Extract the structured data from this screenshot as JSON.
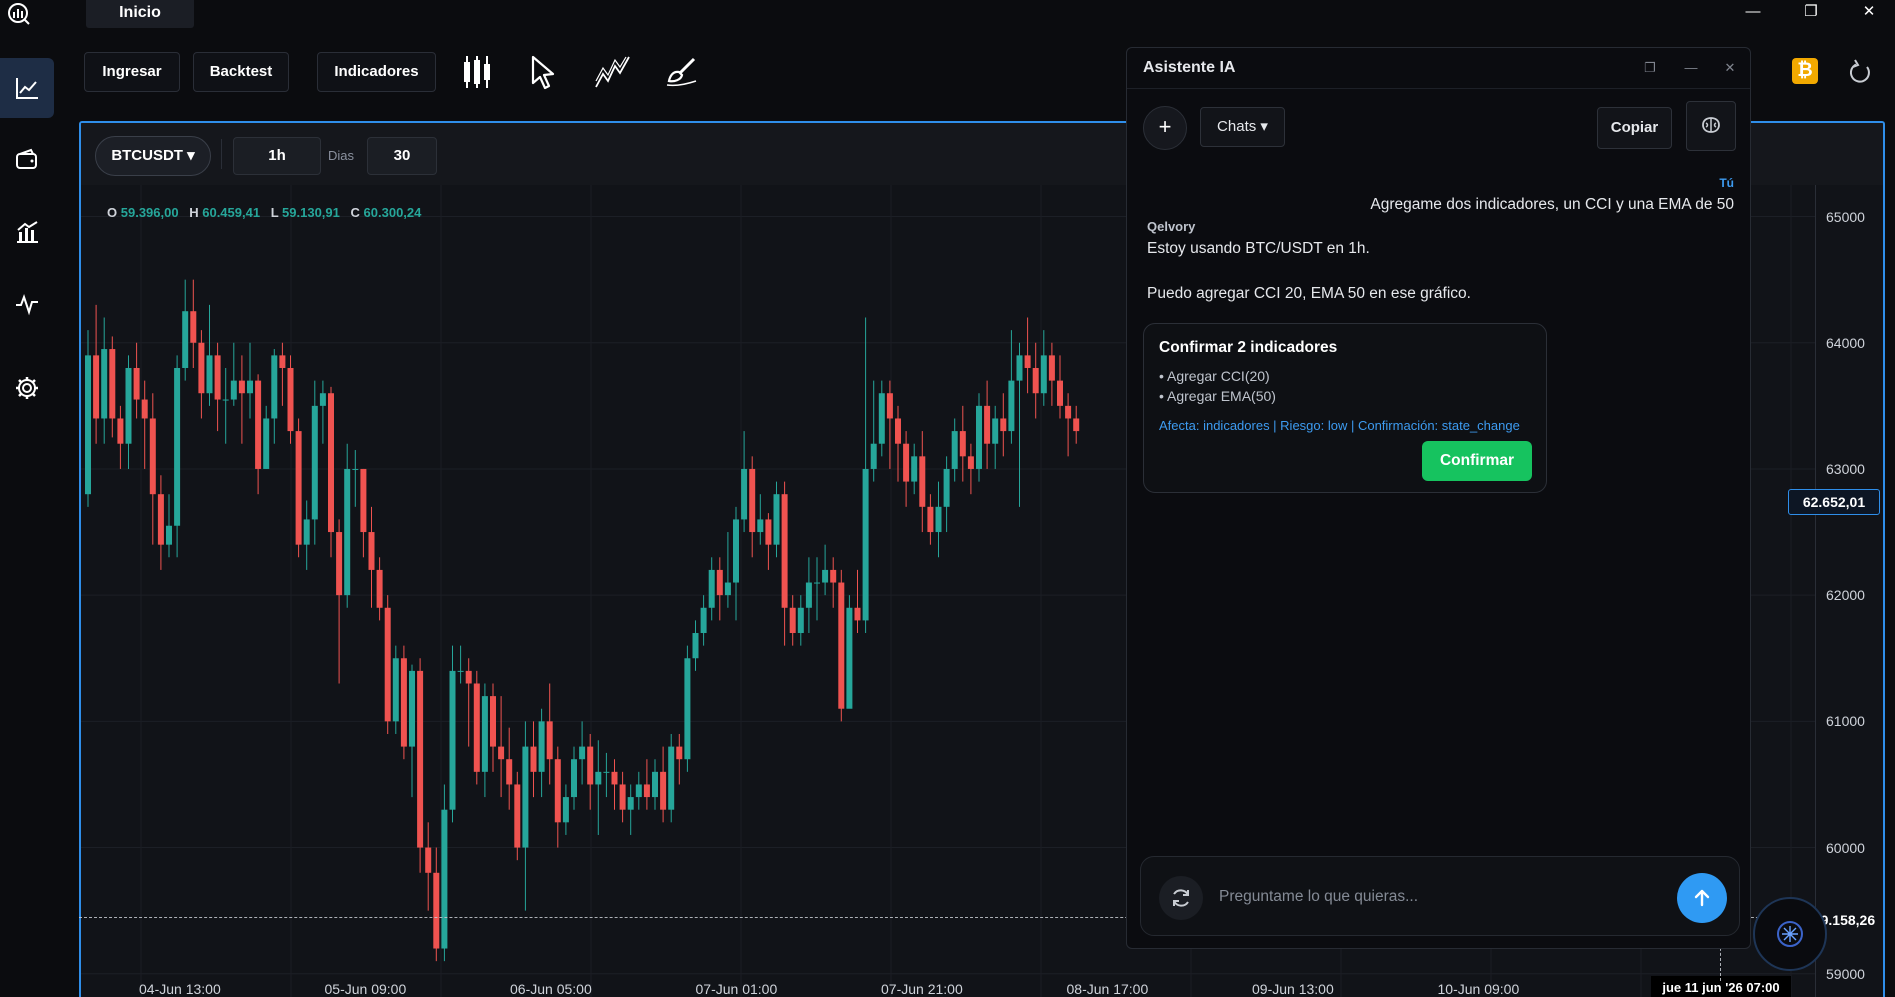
{
  "window": {
    "tab_label": "Inicio",
    "minimize": "—",
    "maximize": "❐",
    "close": "✕"
  },
  "toolbar": {
    "ingresar": "Ingresar",
    "backtest": "Backtest",
    "indicadores": "Indicadores"
  },
  "chart": {
    "symbol": "BTCUSDT ▾",
    "interval": "1h",
    "days_label": "Dias",
    "days_value": "30",
    "ohlc": {
      "o_label": "O",
      "o": "59.396,00",
      "h_label": "H",
      "h": "60.459,41",
      "l_label": "L",
      "l": "59.130,91",
      "c_label": "C",
      "c": "60.300,24"
    },
    "current_price": "62.652,01",
    "crosshair_price": "59.158,26",
    "crosshair_time": "jue 11 jun '26  07:00",
    "up_color": "#26a69a",
    "down_color": "#ef5350",
    "price_ticks": [
      "65000",
      "64000",
      "63000",
      "62000",
      "61000",
      "60000",
      "59000"
    ],
    "time_ticks": [
      "04-Jun 13:00",
      "05-Jun 09:00",
      "06-Jun 05:00",
      "07-Jun 01:00",
      "07-Jun 21:00",
      "08-Jun 17:00",
      "09-Jun 13:00",
      "10-Jun 09:00"
    ]
  },
  "chart_data": {
    "type": "candlestick",
    "ylim": [
      58800,
      65250
    ],
    "x_unit": "1h candles",
    "candles": [
      [
        62800,
        63900,
        64100,
        62700
      ],
      [
        63900,
        63400,
        64300,
        63200
      ],
      [
        63400,
        63950,
        64200,
        63200
      ],
      [
        63950,
        63400,
        64050,
        63250
      ],
      [
        63400,
        63200,
        63500,
        63000
      ],
      [
        63200,
        63800,
        63900,
        63000
      ],
      [
        63800,
        63550,
        64000,
        63400
      ],
      [
        63550,
        63400,
        63700,
        63000
      ],
      [
        63400,
        62800,
        63600,
        62400
      ],
      [
        62800,
        62400,
        62950,
        62200
      ],
      [
        62400,
        62550,
        62800,
        62300
      ],
      [
        62550,
        63800,
        63900,
        62300
      ],
      [
        63800,
        64250,
        64500,
        63700
      ],
      [
        64250,
        64000,
        64500,
        63800
      ],
      [
        64000,
        63600,
        64100,
        63400
      ],
      [
        63600,
        63900,
        64300,
        63500
      ],
      [
        63900,
        63550,
        64000,
        63300
      ],
      [
        63550,
        63550,
        63800,
        63200
      ],
      [
        63550,
        63700,
        64000,
        63500
      ],
      [
        63700,
        63600,
        63900,
        63200
      ],
      [
        63600,
        63700,
        64000,
        63400
      ],
      [
        63700,
        63000,
        63750,
        62800
      ],
      [
        63000,
        63400,
        63500,
        63000
      ],
      [
        63400,
        63900,
        63950,
        63200
      ],
      [
        63900,
        63800,
        64000,
        63500
      ],
      [
        63800,
        63300,
        63900,
        63200
      ],
      [
        63300,
        62400,
        63400,
        62300
      ],
      [
        62400,
        62600,
        62750,
        62200
      ],
      [
        62600,
        63500,
        63700,
        62400
      ],
      [
        63500,
        63600,
        63700,
        63200
      ],
      [
        63600,
        62500,
        63650,
        62300
      ],
      [
        62500,
        62000,
        62600,
        61300
      ],
      [
        62000,
        63000,
        63200,
        61900
      ],
      [
        63000,
        63000,
        63150,
        62700
      ],
      [
        63000,
        62500,
        63000,
        62300
      ],
      [
        62500,
        62200,
        62700,
        61900
      ],
      [
        62200,
        61900,
        62300,
        61800
      ],
      [
        61900,
        61000,
        62000,
        60900
      ],
      [
        61000,
        61500,
        61600,
        60900
      ],
      [
        61500,
        60800,
        61600,
        60700
      ],
      [
        60800,
        61400,
        61450,
        60400
      ],
      [
        61400,
        60000,
        61500,
        59800
      ],
      [
        60000,
        59800,
        60200,
        59500
      ],
      [
        59800,
        59200,
        60000,
        59100
      ],
      [
        59200,
        60300,
        60500,
        59100
      ],
      [
        60300,
        61400,
        61600,
        60200
      ],
      [
        61400,
        61400,
        61600,
        61300
      ],
      [
        61400,
        61300,
        61500,
        60800
      ],
      [
        61300,
        60600,
        61400,
        60500
      ],
      [
        60600,
        61200,
        61300,
        60400
      ],
      [
        61200,
        60800,
        61300,
        60600
      ],
      [
        60800,
        60700,
        61200,
        60400
      ],
      [
        60700,
        60500,
        60950,
        60300
      ],
      [
        60500,
        60000,
        60600,
        59900
      ],
      [
        60000,
        60800,
        61000,
        59500
      ],
      [
        60800,
        60600,
        61000,
        60400
      ],
      [
        60600,
        61000,
        61100,
        60400
      ],
      [
        61000,
        60700,
        61300,
        60500
      ],
      [
        60700,
        60200,
        60800,
        60000
      ],
      [
        60200,
        60400,
        60500,
        60100
      ],
      [
        60400,
        60700,
        60800,
        60300
      ],
      [
        60700,
        60800,
        61000,
        60500
      ],
      [
        60800,
        60500,
        60900,
        60300
      ],
      [
        60500,
        60600,
        60850,
        60100
      ],
      [
        60600,
        60600,
        60750,
        60400
      ],
      [
        60600,
        60500,
        60700,
        60300
      ],
      [
        60500,
        60300,
        60600,
        60200
      ],
      [
        60300,
        60400,
        60500,
        60100
      ],
      [
        60400,
        60500,
        60600,
        60300
      ],
      [
        60500,
        60400,
        60700,
        60300
      ],
      [
        60400,
        60600,
        60700,
        60300
      ],
      [
        60600,
        60300,
        60800,
        60200
      ],
      [
        60300,
        60800,
        60900,
        60200
      ],
      [
        60800,
        60700,
        60900,
        60500
      ],
      [
        60700,
        61500,
        61600,
        60600
      ],
      [
        61500,
        61700,
        61800,
        61400
      ],
      [
        61700,
        61900,
        62000,
        61600
      ],
      [
        61900,
        62200,
        62300,
        61800
      ],
      [
        62200,
        62000,
        62300,
        61800
      ],
      [
        62000,
        62100,
        62500,
        61900
      ],
      [
        62100,
        62600,
        62700,
        61800
      ],
      [
        62600,
        63000,
        63300,
        62500
      ],
      [
        63000,
        62500,
        63100,
        62300
      ],
      [
        62500,
        62600,
        62800,
        62400
      ],
      [
        62600,
        62400,
        62650,
        62200
      ],
      [
        62400,
        62800,
        62900,
        62300
      ],
      [
        62800,
        61900,
        62900,
        61600
      ],
      [
        61900,
        61700,
        62000,
        61600
      ],
      [
        61700,
        61900,
        62000,
        61600
      ],
      [
        61900,
        62100,
        62300,
        61700
      ],
      [
        62100,
        62100,
        62300,
        61800
      ],
      [
        62100,
        62200,
        62400,
        62000
      ],
      [
        62200,
        62100,
        62300,
        61900
      ],
      [
        62100,
        61100,
        62200,
        61000
      ],
      [
        61100,
        61900,
        62000,
        61200
      ],
      [
        61900,
        61800,
        62200,
        61700
      ],
      [
        61800,
        63000,
        64200,
        61700
      ],
      [
        63000,
        63200,
        63700,
        62900
      ],
      [
        63200,
        63600,
        63700,
        63100
      ],
      [
        63600,
        63400,
        63700,
        63000
      ],
      [
        63400,
        63200,
        63500,
        62900
      ],
      [
        63200,
        62900,
        63300,
        62700
      ],
      [
        62900,
        63100,
        63200,
        62800
      ],
      [
        63100,
        62700,
        63300,
        62500
      ],
      [
        62700,
        62500,
        62800,
        62400
      ],
      [
        62500,
        62700,
        62900,
        62300
      ],
      [
        62700,
        63000,
        63100,
        62500
      ],
      [
        63000,
        63300,
        63400,
        62900
      ],
      [
        63300,
        63100,
        63500,
        62900
      ],
      [
        63100,
        63000,
        63200,
        62800
      ],
      [
        63000,
        63500,
        63600,
        62900
      ],
      [
        63500,
        63200,
        63700,
        63000
      ],
      [
        63200,
        63400,
        63500,
        63000
      ],
      [
        63400,
        63300,
        63600,
        63100
      ],
      [
        63300,
        63700,
        64100,
        63200
      ],
      [
        63700,
        63900,
        64000,
        62700
      ],
      [
        63900,
        63800,
        64200,
        63600
      ],
      [
        63800,
        63600,
        64000,
        63400
      ],
      [
        63600,
        63900,
        64100,
        63500
      ],
      [
        63900,
        63700,
        64000,
        63500
      ],
      [
        63700,
        63500,
        63900,
        63400
      ],
      [
        63500,
        63400,
        63600,
        63100
      ],
      [
        63400,
        63300,
        63500,
        63200
      ]
    ]
  },
  "assistant": {
    "title": "Asistente IA",
    "restore": "❐",
    "minimize": "—",
    "close": "✕",
    "new_chat": "+",
    "chats": "Chats ▾",
    "copy": "Copiar",
    "you_label": "Tú",
    "you_message": "Agregame dos indicadores, un CCI y una EMA de 50",
    "bot_name": "Qelvory",
    "bot_line1": "Estoy usando BTC/USDT en 1h.",
    "bot_line2": "Puedo agregar CCI 20, EMA 50 en ese gráfico.",
    "card": {
      "title": "Confirmar 2 indicadores",
      "item1": "• Agregar CCI(20)",
      "item2": "• Agregar EMA(50)",
      "meta": "Afecta: indicadores | Riesgo: low | Confirmación: state_change",
      "confirm": "Confirmar"
    },
    "input_placeholder": "Preguntame lo que quieras...",
    "accent": "#2f9af3",
    "confirm_color": "#16c35f"
  },
  "top_right": {
    "btc_badge": "₿"
  }
}
